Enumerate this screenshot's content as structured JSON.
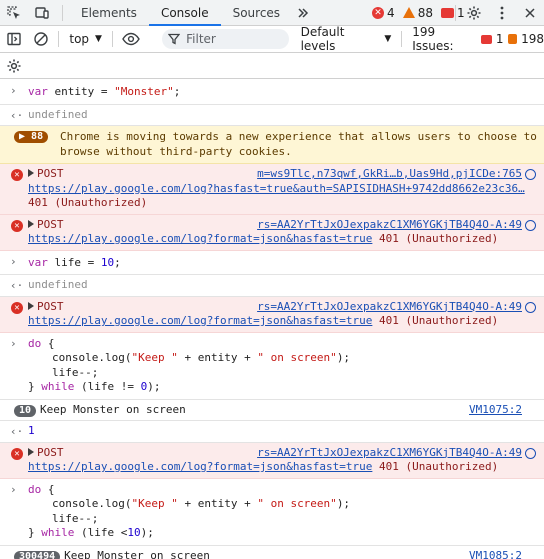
{
  "tabs": [
    "Elements",
    "Console",
    "Sources"
  ],
  "counters": {
    "errors": "4",
    "warnings": "88",
    "issues": "1"
  },
  "toolbar": {
    "context": "top",
    "filter_placeholder": "Filter",
    "levels": "Default levels",
    "issues_label": "199 Issues:",
    "issues_errors": "1",
    "issues_warnings": "198"
  },
  "console": {
    "r1": {
      "kw": "var",
      "rest1": " entity = ",
      "str": "\"Monster\"",
      "rest2": ";"
    },
    "r2": "undefined",
    "r3": {
      "badge": "88",
      "text": "Chrome is moving towards a new experience that allows users to choose to browse without third-party cookies."
    },
    "r4": {
      "method": "POST",
      "source": "m=ws9Tlc,n73qwf,GkRi…b,Uas9Hd,pjICDe:765",
      "url": "https://play.google.com/log?hasfast=true&auth=SAPISIDHASH+9742dd8662e23c36…",
      "status": "401 (Unauthorized)"
    },
    "r5": {
      "method": "POST",
      "source": "rs=AA2YrTtJxOJexpakzC1XM6YGKjTB4Q4O-A:49",
      "url": "https://play.google.com/log?format=json&hasfast=true",
      "status": " 401 (Unauthorized)"
    },
    "r6": {
      "kw": "var",
      "rest": " life = ",
      "num": "10",
      "end": ";"
    },
    "r7": "undefined",
    "r8": {
      "method": "POST",
      "source": "rs=AA2YrTtJxOJexpakzC1XM6YGKjTB4Q4O-A:49",
      "url": "https://play.google.com/log?format=json&hasfast=true",
      "status": " 401 (Unauthorized)"
    },
    "r9": {
      "l1a": "do",
      "l1b": " {",
      "l2a": "console.log(",
      "l2b": "\"Keep \"",
      "l2c": " + entity + ",
      "l2d": "\" on screen\"",
      "l2e": ");",
      "l3": "life--;",
      "l4a": "} ",
      "l4b": "while",
      "l4c": " (life != ",
      "l4d": "0",
      "l4e": ");"
    },
    "r10": {
      "badge": "10",
      "text": "Keep Monster on screen",
      "source": "VM1075:2"
    },
    "r11": "1",
    "r12": {
      "method": "POST",
      "source": "rs=AA2YrTtJxOJexpakzC1XM6YGKjTB4Q4O-A:49",
      "url": "https://play.google.com/log?format=json&hasfast=true",
      "status": " 401 (Unauthorized)"
    },
    "r13": {
      "l1a": "do",
      "l1b": " {",
      "l2a": "console.log(",
      "l2b": "\"Keep \"",
      "l2c": " + entity + ",
      "l2d": "\" on screen\"",
      "l2e": ");",
      "l3": "life--;",
      "l4a": "} ",
      "l4b": "while",
      "l4c": " (life <",
      "l4d": "10",
      "l4e": ");"
    },
    "r14": {
      "badge": "300494",
      "text": "Keep Monster on screen",
      "source": "VM1085:2"
    }
  }
}
